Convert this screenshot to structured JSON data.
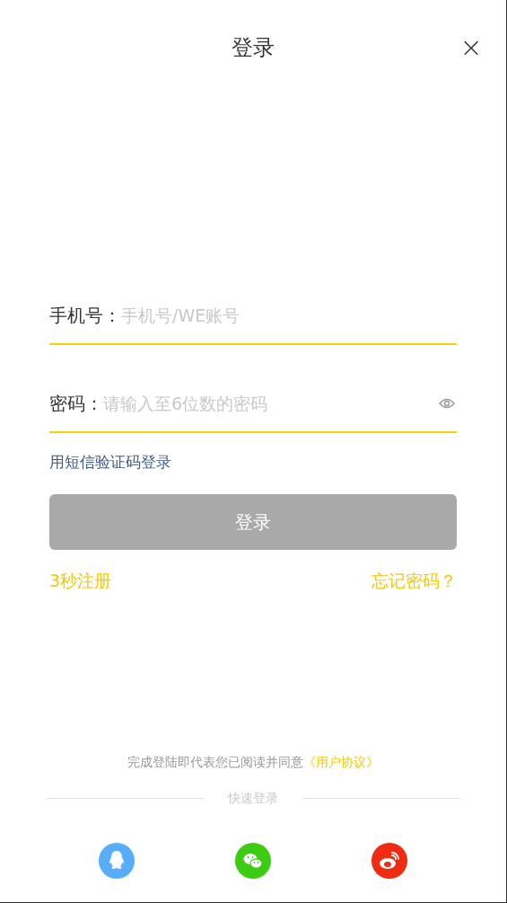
{
  "header": {
    "title": "登录",
    "close_icon": "×"
  },
  "fields": [
    {
      "label": "手机号：",
      "placeholder": "手机号/WE账号",
      "kind": "text"
    },
    {
      "label": "密码：",
      "placeholder": "请输入至6位数的密码",
      "kind": "password"
    }
  ],
  "sms_login_link": "用短信验证码登录",
  "login_button": {
    "label": "登录",
    "disabled": true
  },
  "register_link": "3秒注册",
  "forgot_link": "忘记密码？",
  "agreement": {
    "text": "完成登陆即代表您已阅读并同意",
    "link": "《用户协议》"
  },
  "quick_login": {
    "label": "快速登录",
    "providers": [
      {
        "kind": "qq",
        "color": "#57adf9"
      },
      {
        "kind": "wechat",
        "color": "#3ccd12"
      },
      {
        "kind": "weibo",
        "color": "#ef2b12"
      }
    ]
  }
}
